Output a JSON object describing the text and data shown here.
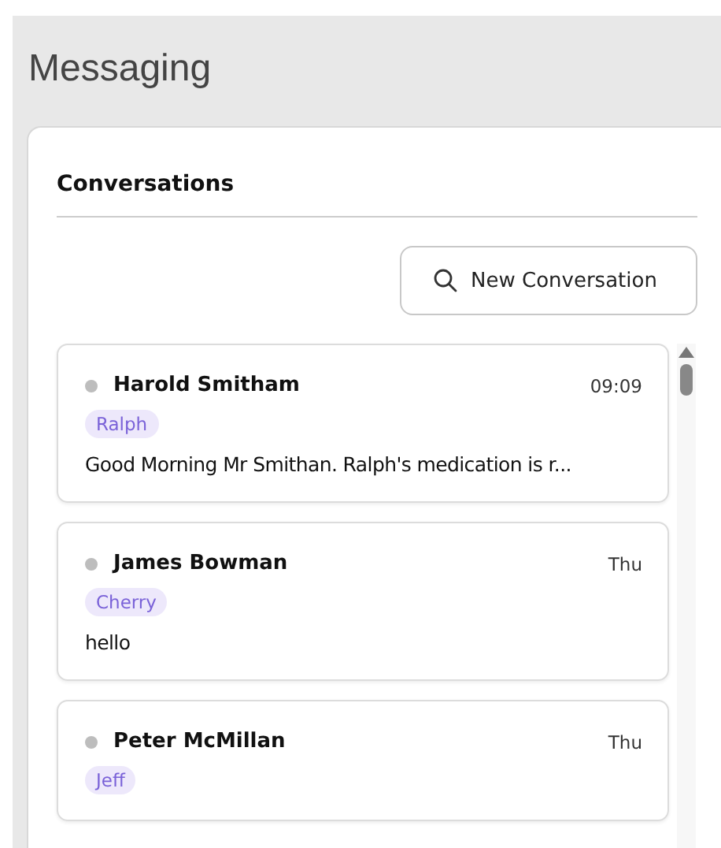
{
  "page": {
    "title": "Messaging"
  },
  "panel": {
    "heading": "Conversations",
    "new_button": "New Conversation"
  },
  "conversations": [
    {
      "name": "Harold Smitham",
      "time": "09:09",
      "tag": "Ralph",
      "preview": "Good Morning Mr Smithan. Ralph's medication is r..."
    },
    {
      "name": "James Bowman",
      "time": "Thu",
      "tag": "Cherry",
      "preview": "hello"
    },
    {
      "name": "Peter McMillan",
      "time": "Thu",
      "tag": "Jeff"
    }
  ]
}
